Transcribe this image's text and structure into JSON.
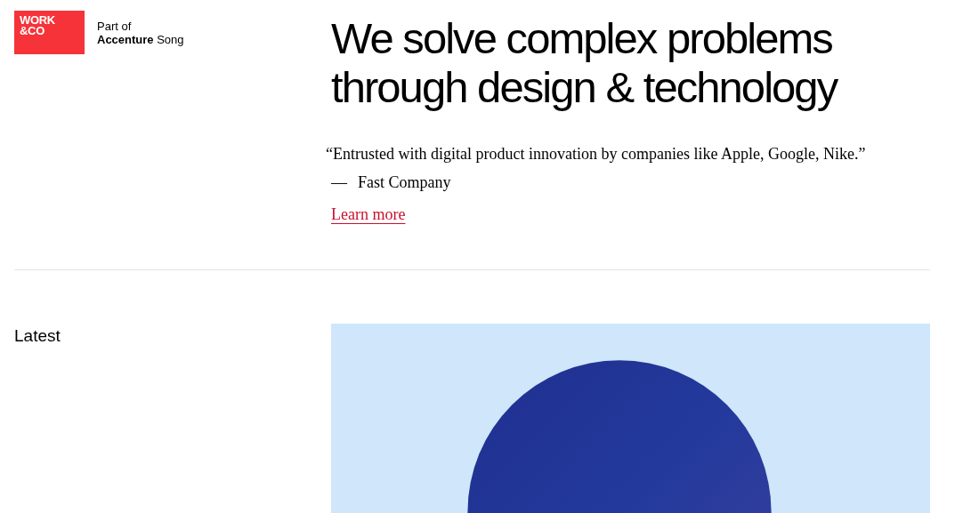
{
  "logo": {
    "lines": [
      "WORK",
      "&CO"
    ]
  },
  "affiliation": {
    "lines": [
      "Part of",
      "**Accenture** Song"
    ]
  },
  "headline": [
    "We solve complex problems",
    "through design & technology"
  ],
  "quote": {
    "text": "“Entrusted with digital product innovation by companies like Apple, Google, Nike.”",
    "dash": "—",
    "source": "Fast Company"
  },
  "link": "Learn more",
  "latest": {
    "heading": "Latest"
  }
}
